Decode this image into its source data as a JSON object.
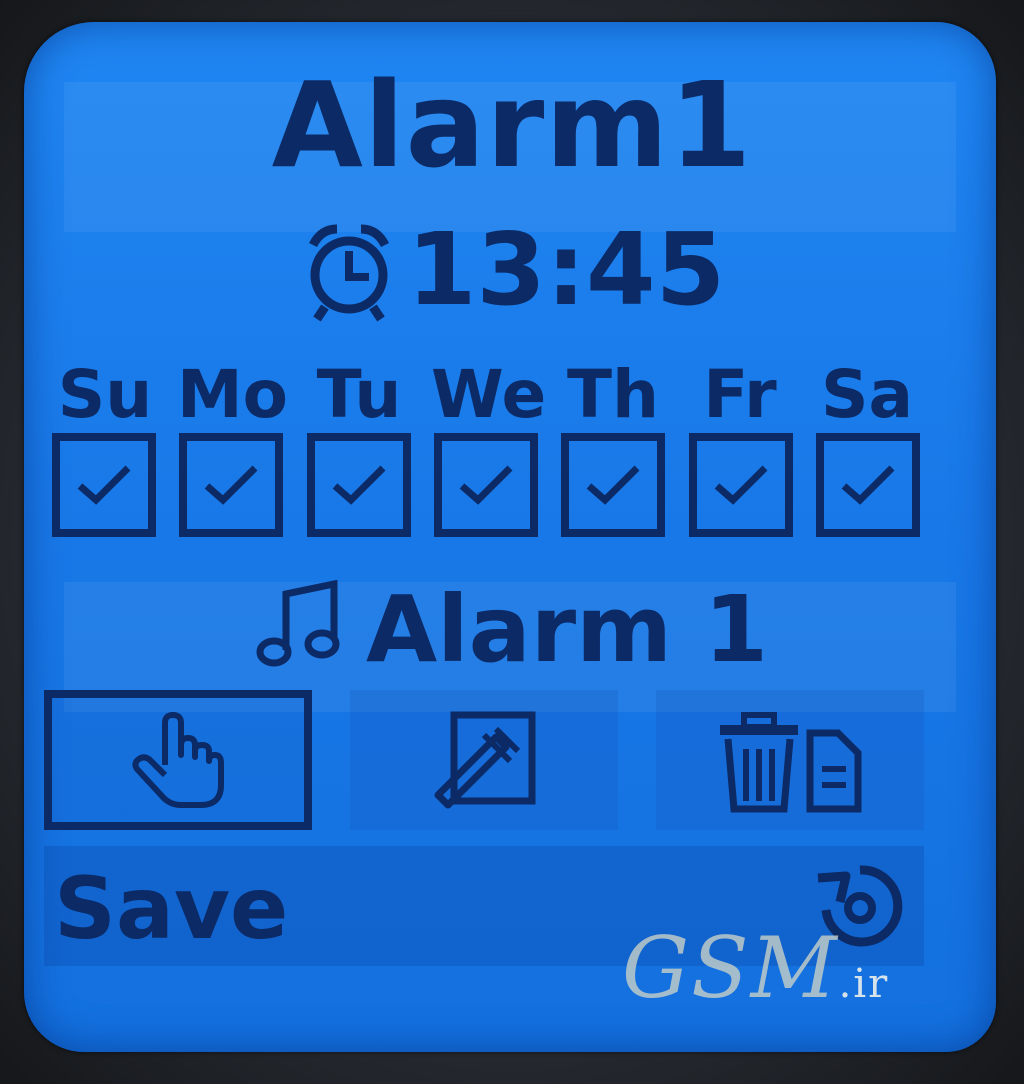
{
  "alarm": {
    "title": "Alarm1",
    "time": "13:45",
    "tone": "Alarm 1"
  },
  "days": [
    {
      "label": "Su",
      "checked": true
    },
    {
      "label": "Mo",
      "checked": true
    },
    {
      "label": "Tu",
      "checked": true
    },
    {
      "label": "We",
      "checked": true
    },
    {
      "label": "Th",
      "checked": true
    },
    {
      "label": "Fr",
      "checked": true
    },
    {
      "label": "Sa",
      "checked": true
    }
  ],
  "actions": [
    {
      "icon": "hand-pointer-icon",
      "selected": true
    },
    {
      "icon": "edit-pencil-icon",
      "selected": false
    },
    {
      "icon": "trash-delete-icon",
      "selected": false
    }
  ],
  "softkeys": {
    "left": "Save",
    "right_icon": "return-icon"
  },
  "watermark": {
    "main": "GSM",
    "sub": ".ir"
  },
  "colors": {
    "screen": "#1979e8",
    "ink": "#0b2a66"
  }
}
